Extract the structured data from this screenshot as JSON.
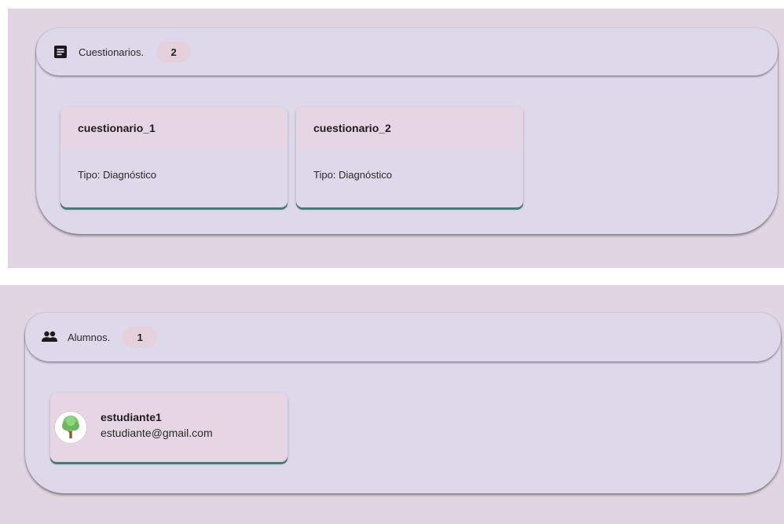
{
  "cuestionarios": {
    "title": "Cuestionarios.",
    "icon": "document-icon",
    "count": "2",
    "items": [
      {
        "name": "cuestionario_1",
        "tipo": "Tipo: Diagnóstico"
      },
      {
        "name": "cuestionario_2",
        "tipo": "Tipo: Diagnóstico"
      }
    ]
  },
  "alumnos": {
    "title": "Alumnos.",
    "icon": "people-icon",
    "count": "1",
    "items": [
      {
        "name": "estudiante1",
        "email": "estudiante@gmail.com",
        "avatar": "tree-avatar-icon"
      }
    ]
  },
  "colors": {
    "background": "#e2d5e3",
    "card": "#ddd8ea",
    "card_head": "#e6d6e4",
    "badge": "#e6d0dc",
    "accent": "#4f7678"
  }
}
